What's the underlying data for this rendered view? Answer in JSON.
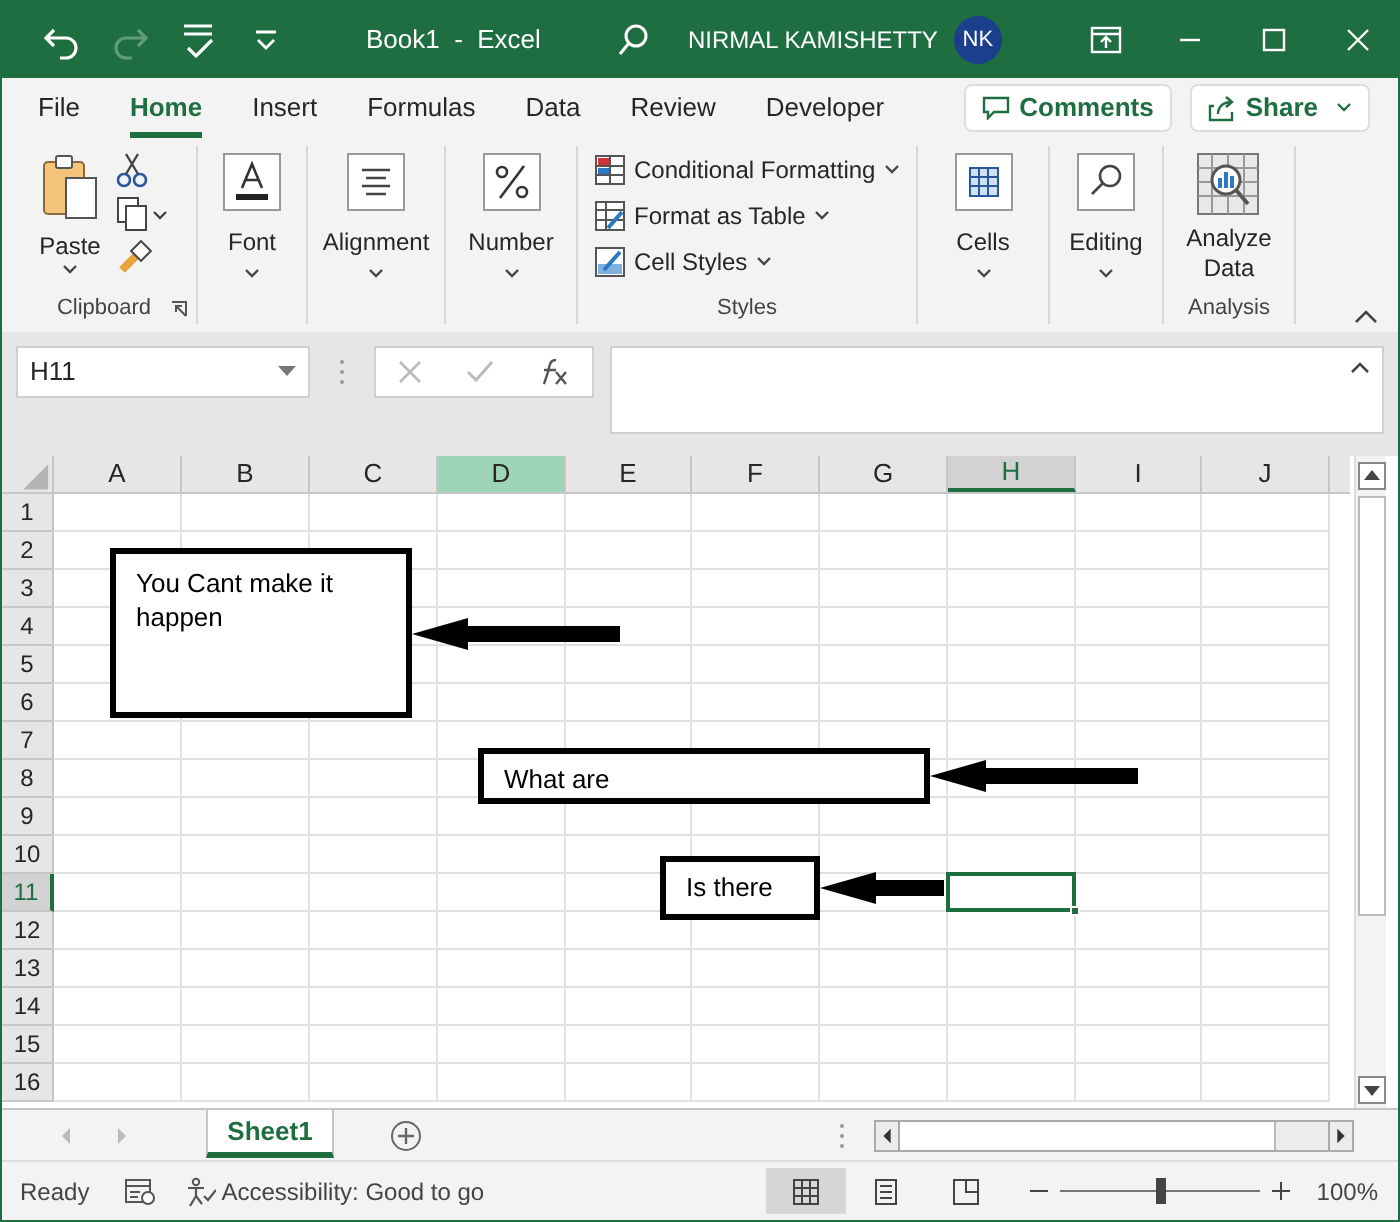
{
  "title_bar": {
    "quick_access": [
      {
        "kind": "undo",
        "disabled": false
      },
      {
        "kind": "redo",
        "disabled": true
      },
      {
        "kind": "spelling",
        "disabled": false
      },
      {
        "kind": "customize",
        "disabled": false
      }
    ],
    "title": "Book1  -  Excel",
    "user_name": "NIRMAL KAMISHETTY",
    "avatar": "NK"
  },
  "menu_tabs": [
    {
      "label": "File",
      "selected": false
    },
    {
      "label": "Home",
      "selected": true
    },
    {
      "label": "Insert",
      "selected": false
    },
    {
      "label": "Formulas",
      "selected": false
    },
    {
      "label": "Data",
      "selected": false
    },
    {
      "label": "Review",
      "selected": false
    },
    {
      "label": "Developer",
      "selected": false
    }
  ],
  "comments_button": "Comments",
  "share_button": "Share",
  "ribbon": {
    "groups": [
      {
        "kind": "clipboard",
        "label": "Clipboard",
        "buttons": [
          {
            "label": "Paste",
            "kind": "paste"
          }
        ]
      },
      {
        "kind": "large",
        "buttons": [
          {
            "label": "Font",
            "kind": "font"
          }
        ]
      },
      {
        "kind": "large",
        "buttons": [
          {
            "label": "Alignment",
            "kind": "align"
          }
        ]
      },
      {
        "kind": "large",
        "buttons": [
          {
            "label": "Number",
            "kind": "percent"
          }
        ]
      },
      {
        "kind": "styles",
        "label": "Styles",
        "buttons": [
          {
            "label": "Conditional Formatting",
            "kind": "cond"
          },
          {
            "label": "Format as Table",
            "kind": "table"
          },
          {
            "label": "Cell Styles",
            "kind": "styles"
          }
        ]
      },
      {
        "kind": "large",
        "buttons": [
          {
            "label": "Cells",
            "kind": "cells"
          }
        ]
      },
      {
        "kind": "large",
        "buttons": [
          {
            "label": "Editing",
            "kind": "search"
          }
        ]
      },
      {
        "kind": "analyze",
        "label": "Analysis",
        "buttons": [
          {
            "label": "Analyze\nData",
            "kind": "analyze"
          }
        ]
      }
    ]
  },
  "name_box": "H11",
  "columns": [
    {
      "label": "A",
      "selected": false,
      "highlighted": false
    },
    {
      "label": "B",
      "selected": false,
      "highlighted": false
    },
    {
      "label": "C",
      "selected": false,
      "highlighted": false
    },
    {
      "label": "D",
      "selected": false,
      "highlighted": true
    },
    {
      "label": "E",
      "selected": false,
      "highlighted": false
    },
    {
      "label": "F",
      "selected": false,
      "highlighted": false
    },
    {
      "label": "G",
      "selected": false,
      "highlighted": false
    },
    {
      "label": "H",
      "selected": true,
      "highlighted": false
    },
    {
      "label": "I",
      "selected": false,
      "highlighted": false
    },
    {
      "label": "J",
      "selected": false,
      "highlighted": false
    }
  ],
  "rows": [
    {
      "label": "1",
      "selected": false
    },
    {
      "label": "2",
      "selected": false
    },
    {
      "label": "3",
      "selected": false
    },
    {
      "label": "4",
      "selected": false
    },
    {
      "label": "5",
      "selected": false
    },
    {
      "label": "6",
      "selected": false
    },
    {
      "label": "7",
      "selected": false
    },
    {
      "label": "8",
      "selected": false
    },
    {
      "label": "9",
      "selected": false
    },
    {
      "label": "10",
      "selected": false
    },
    {
      "label": "11",
      "selected": true
    },
    {
      "label": "12",
      "selected": false
    },
    {
      "label": "13",
      "selected": false
    },
    {
      "label": "14",
      "selected": false
    },
    {
      "label": "15",
      "selected": false
    },
    {
      "label": "16",
      "selected": false
    }
  ],
  "shapes": [
    {
      "text": "You Cant make it happen"
    },
    {
      "text": "What are"
    },
    {
      "text": "Is there"
    }
  ],
  "sheet_tabs": [
    {
      "label": "Sheet1",
      "selected": true
    }
  ],
  "status_bar": {
    "ready": "Ready",
    "accessibility": "Accessibility: Good to go",
    "views": [
      {
        "kind": "normal",
        "selected": true
      },
      {
        "kind": "page_layout",
        "selected": false
      },
      {
        "kind": "page_break",
        "selected": false
      }
    ],
    "zoom": {
      "level": 0.5,
      "reading": "100%"
    }
  }
}
